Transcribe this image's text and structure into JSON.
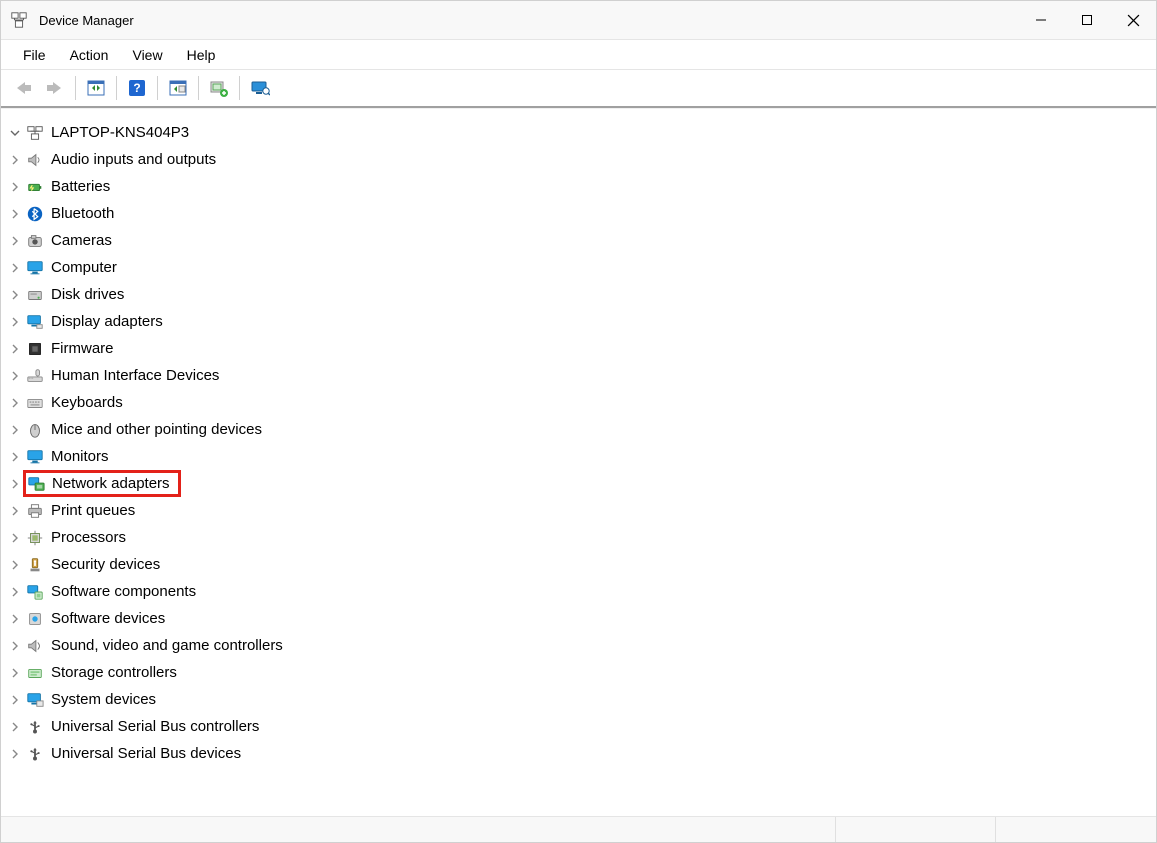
{
  "window": {
    "title": "Device Manager"
  },
  "menu": {
    "file": "File",
    "action": "Action",
    "view": "View",
    "help": "Help"
  },
  "toolbar_icons": {
    "back": "back-icon",
    "forward": "forward-icon",
    "show_hide": "show-hide-tree-icon",
    "help": "help-icon",
    "scan": "scan-hardware-icon",
    "add_legacy": "add-legacy-hardware-icon",
    "remote": "remote-computer-icon"
  },
  "tree": {
    "root": {
      "label": "LAPTOP-KNS404P3",
      "expanded": true
    },
    "items": [
      {
        "label": "Audio inputs and outputs",
        "icon": "speaker-icon",
        "highlighted": false
      },
      {
        "label": "Batteries",
        "icon": "battery-icon",
        "highlighted": false
      },
      {
        "label": "Bluetooth",
        "icon": "bluetooth-icon",
        "highlighted": false
      },
      {
        "label": "Cameras",
        "icon": "camera-icon",
        "highlighted": false
      },
      {
        "label": "Computer",
        "icon": "monitor-icon",
        "highlighted": false
      },
      {
        "label": "Disk drives",
        "icon": "disk-icon",
        "highlighted": false
      },
      {
        "label": "Display adapters",
        "icon": "display-adapter-icon",
        "highlighted": false
      },
      {
        "label": "Firmware",
        "icon": "firmware-icon",
        "highlighted": false
      },
      {
        "label": "Human Interface Devices",
        "icon": "hid-icon",
        "highlighted": false
      },
      {
        "label": "Keyboards",
        "icon": "keyboard-icon",
        "highlighted": false
      },
      {
        "label": "Mice and other pointing devices",
        "icon": "mouse-icon",
        "highlighted": false
      },
      {
        "label": "Monitors",
        "icon": "monitor-icon",
        "highlighted": false
      },
      {
        "label": "Network adapters",
        "icon": "network-adapter-icon",
        "highlighted": true
      },
      {
        "label": "Print queues",
        "icon": "printer-icon",
        "highlighted": false
      },
      {
        "label": "Processors",
        "icon": "cpu-icon",
        "highlighted": false
      },
      {
        "label": "Security devices",
        "icon": "security-icon",
        "highlighted": false
      },
      {
        "label": "Software components",
        "icon": "software-component-icon",
        "highlighted": false
      },
      {
        "label": "Software devices",
        "icon": "software-device-icon",
        "highlighted": false
      },
      {
        "label": "Sound, video and game controllers",
        "icon": "sound-controller-icon",
        "highlighted": false
      },
      {
        "label": "Storage controllers",
        "icon": "storage-controller-icon",
        "highlighted": false
      },
      {
        "label": "System devices",
        "icon": "system-device-icon",
        "highlighted": false
      },
      {
        "label": "Universal Serial Bus controllers",
        "icon": "usb-icon",
        "highlighted": false
      },
      {
        "label": "Universal Serial Bus devices",
        "icon": "usb-icon",
        "highlighted": false
      }
    ]
  }
}
